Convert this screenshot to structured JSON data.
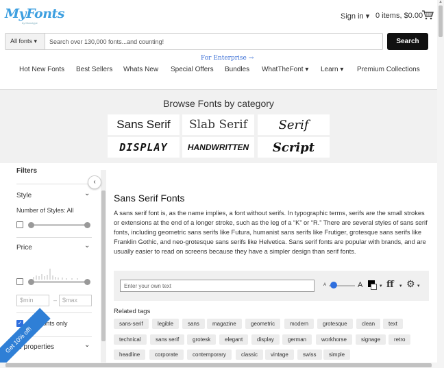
{
  "header": {
    "logo_text": "MyFonts",
    "logo_sub": "by Monotype",
    "signin_label": "Sign in ▾",
    "cart_label": "0 items, $0.00"
  },
  "search": {
    "category": "All fonts ▾",
    "placeholder": "Search over 130,000 fonts...and counting!",
    "button_label": "Search"
  },
  "enterprise": {
    "label": "For Enterprise",
    "arrow": "→"
  },
  "nav": {
    "items": [
      {
        "label": "Hot New Fonts"
      },
      {
        "label": "Best Sellers"
      },
      {
        "label": "Whats New"
      },
      {
        "label": "Special Offers"
      },
      {
        "label": "Bundles"
      },
      {
        "label": "WhatTheFont ▾"
      },
      {
        "label": "Learn ▾"
      },
      {
        "label": "Premium Collections"
      }
    ]
  },
  "categories": {
    "title": "Browse Fonts by category",
    "items": [
      {
        "label": "Sans Serif"
      },
      {
        "label": "Slab Serif"
      },
      {
        "label": "Serif"
      },
      {
        "label": "DISPLAY"
      },
      {
        "label": "HANDWRITTEN"
      },
      {
        "label": "Script"
      }
    ]
  },
  "filters": {
    "title": "Filters",
    "style_label": "Style",
    "styles_count": "Number of Styles: All",
    "price_label": "Price",
    "min_placeholder": "$min",
    "max_placeholder": "$max",
    "dash": "–",
    "free_label": "Free fonts only",
    "more_label": "al properties",
    "collapse_glyph": "‹",
    "chevron": "⌄"
  },
  "promo": {
    "label": "Get 10% off!"
  },
  "main": {
    "title": "Sans Serif Fonts",
    "description": "A sans serif font is, as the name implies, a font without serifs. In typographic terms, serifs are the small strokes or extensions at the end of a longer stroke, such as the leg of a “K” or “R.” There are several styles of sans serif fonts, including geometric sans serifs like Futura, humanist sans serifs like Frutiger, grotesque sans serifs like Franklin Gothic, and neo-grotesque sans serifs like Helvetica. Sans serif fonts are popular with brands, and are usually easier to read on screens because they have a simpler design than serif fonts."
  },
  "editor": {
    "placeholder": "Enter your own text",
    "size_small": "A",
    "size_large": "A",
    "caret": "▾",
    "ff_glyph": "ff",
    "gear_glyph": "⚙"
  },
  "related": {
    "title": "Related tags",
    "tags": [
      "sans-serif",
      "legible",
      "sans",
      "magazine",
      "geometric",
      "modern",
      "grotesque",
      "clean",
      "text",
      "technical",
      "sans serif",
      "grotesk",
      "elegant",
      "display",
      "german",
      "workhorse",
      "signage",
      "retro",
      "headline",
      "corporate",
      "contemporary",
      "classic",
      "vintage",
      "swiss",
      "simple"
    ]
  },
  "colors": {
    "accent": "#2f6fde",
    "search_button": "#111111",
    "logo": "#3d9fe0",
    "band": "#f1f1f1"
  },
  "icons": {
    "cart": "cart-icon",
    "promo": "tag-icon"
  }
}
